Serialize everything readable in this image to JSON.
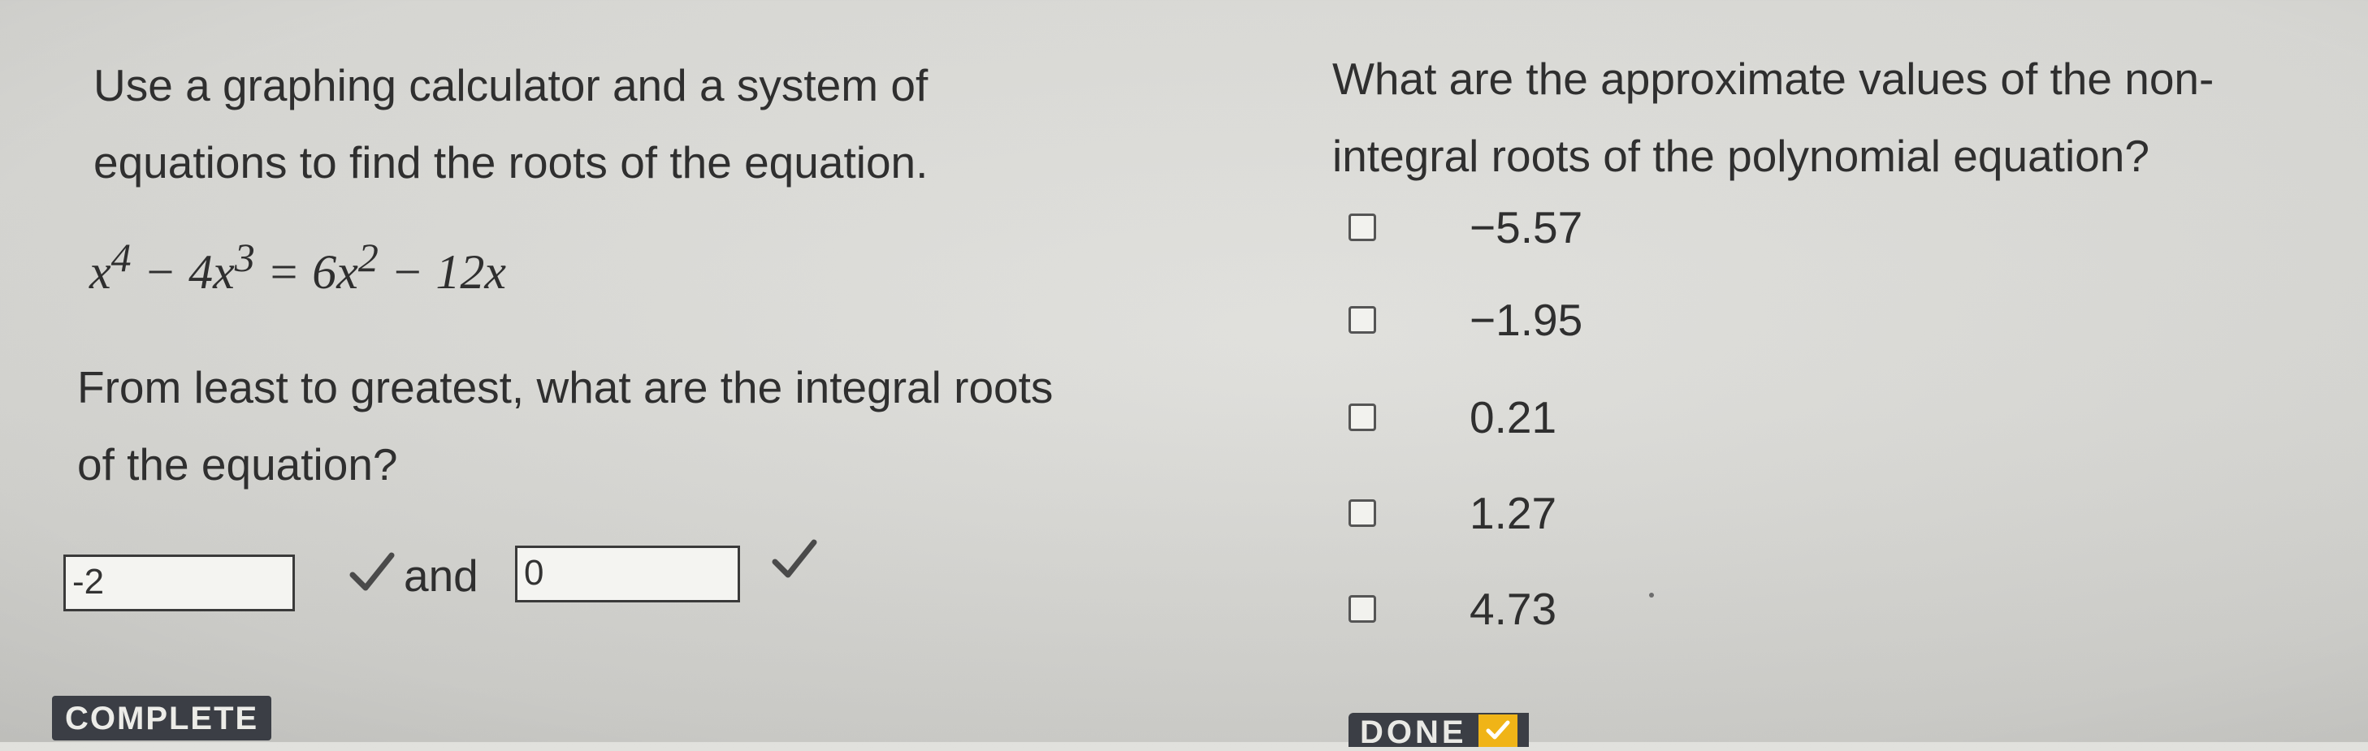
{
  "question1": {
    "prompt_line1": "Use a graphing calculator and a system of",
    "prompt_line2": "equations to find the roots of the equation.",
    "equation": {
      "t1": "x",
      "e1": "4",
      "t2": " − 4x",
      "e2": "3",
      "t3": " = 6x",
      "e3": "2",
      "t4": " − 12x"
    },
    "question_line1": "From least to greatest, what are the integral roots",
    "question_line2": "of the equation?",
    "answer1_value": "-2",
    "and_label": "and",
    "answer2_value": "0"
  },
  "question2": {
    "prompt_line1": "What are the approximate values of the non-",
    "prompt_line2": "integral roots of the polynomial equation?",
    "options": [
      {
        "label": "−5.57",
        "checked": false
      },
      {
        "label": "−1.95",
        "checked": false
      },
      {
        "label": "0.21",
        "checked": false
      },
      {
        "label": "1.27",
        "checked": false
      },
      {
        "label": "4.73",
        "checked": false
      }
    ]
  },
  "status": {
    "complete_label": "COMPLETE",
    "done_label": "DONE"
  },
  "icons": {
    "answer_check": "checkmark-icon",
    "done_check": "checkmark-icon"
  },
  "colors": {
    "background": "#dcdcd8",
    "text": "#2f2f2f",
    "badge": "#3b3e45",
    "done_accent": "#f0b417"
  }
}
